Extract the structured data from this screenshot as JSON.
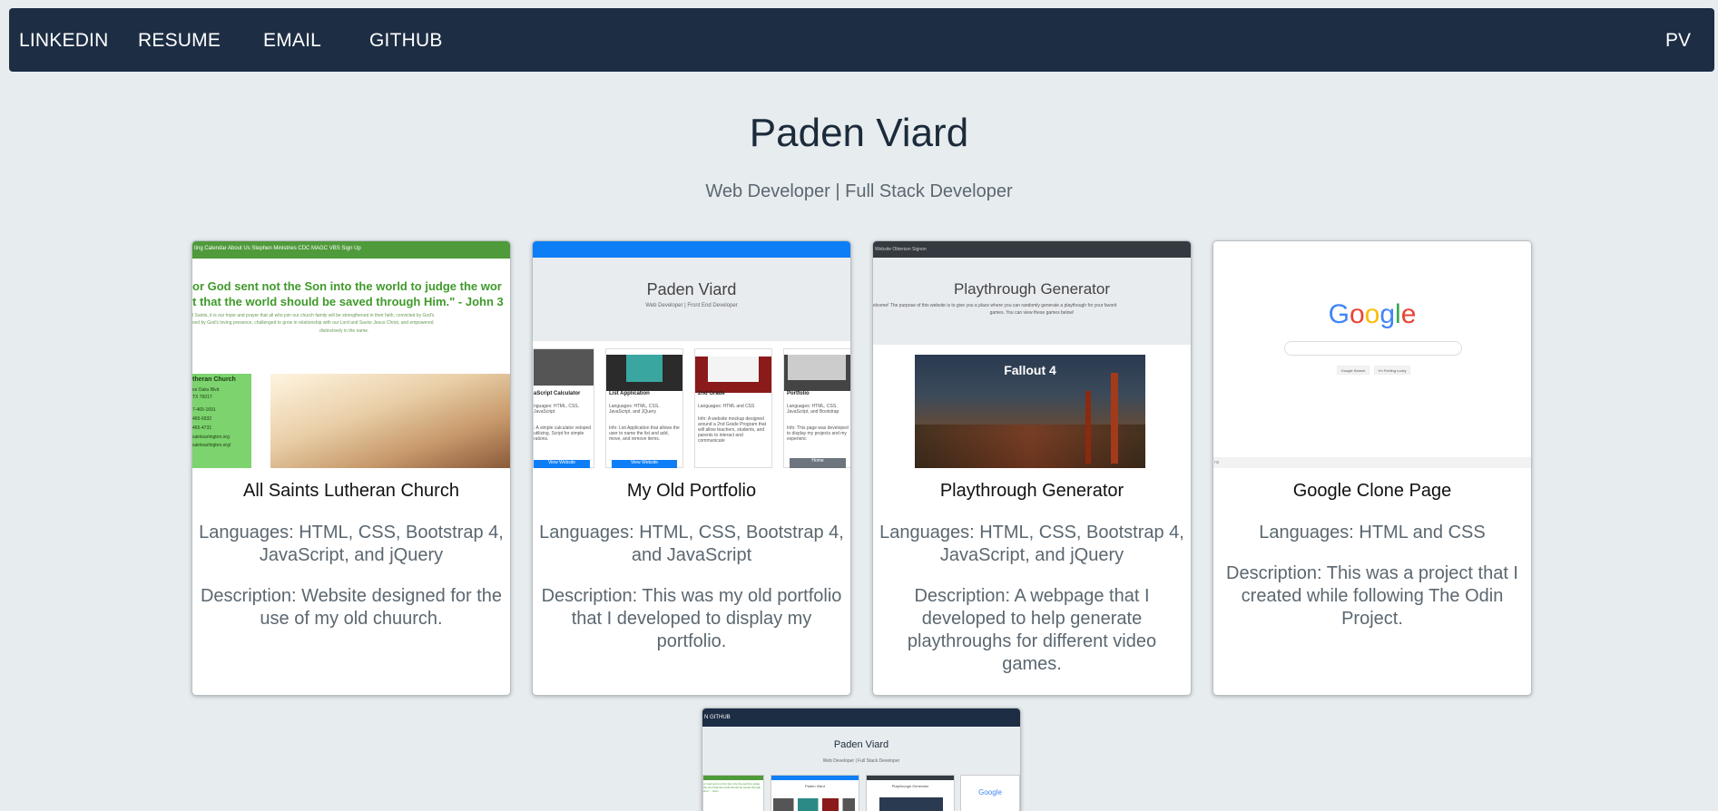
{
  "nav": {
    "links": [
      "LINKEDIN",
      "RESUME",
      "EMAIL",
      "GITHUB"
    ],
    "brand": "PV"
  },
  "hero": {
    "title": "Paden Viard",
    "subtitle": "Web Developer | Full Stack Developer"
  },
  "projects": [
    {
      "title": "All Saints Lutheran Church",
      "languages": "Languages: HTML, CSS, Bootstrap 4, JavaScript, and jQuery",
      "description": "Description: Website designed for the use of my old chuurch.",
      "thumb": {
        "nav_items": "ting  Calendar  About Us  Stephen Ministries  CDC  MAGC  VBS Sign Up",
        "quote_line1": "or God sent not the Son into the world to judge the wor",
        "quote_line2": "t that the world should be saved through Him.\" - John 3",
        "body_line1": "l Saints, it is our hope and prayer that all who join our church family will be strengthened in their faith, convicted by God's",
        "body_line2": "ved by God's loving presence, challenged to grow in relationship with our Lord and Savior Jesus Christ, and empowered",
        "body_line3": "distinctively in the name.",
        "side_title": "theran Church",
        "side_lines": [
          "es Oaks Blvd",
          "TX 76017",
          "7-465-1691",
          "465-6932",
          "465-4731",
          "saintsarlington.org",
          "saintsarlington.org/"
        ]
      }
    },
    {
      "title": "My Old Portfolio",
      "languages": "Languages: HTML, CSS, Bootstrap 4, and JavaScript",
      "description": "Description: This was my old portfolio that I developed to display my portfolio.",
      "thumb": {
        "heading": "Paden Viard",
        "sub": "Web Developer | Front End Developer",
        "tiles": [
          {
            "title": "aScript Calculator",
            "lang": "nguages: HTML, CSS, JavaScript",
            "info": ": A simple calculator veloped utilizing. Script for simple rations.",
            "btn": "View Website"
          },
          {
            "title": "List Application",
            "lang": "Languages: HTML, CSS, JavaScript, and JQuery",
            "info": "Info: List Application that allows the user to name the list and add, move, and remove items.",
            "btn": "View Website"
          },
          {
            "title": "2nd Grade",
            "lang": "Languages: HTML and CSS",
            "info": "Info: A website mockup designed around a 2nd Grade Program that will allow teachers, students, and parents to interact and communicate",
            "btn": ""
          },
          {
            "title": "Portfolio",
            "lang": "Languages: HTML, CSS, JavaScript, and Bootstrap",
            "info": "Info: This page was developed to display my projects and my experienc",
            "btn": "Home"
          }
        ]
      }
    },
    {
      "title": "Playthrough Generator",
      "languages": "Languages: HTML, CSS, Bootstrap 4, JavaScript, and jQuery",
      "description": "Description: A webpage that I developed to help generate playthroughs for different video games.",
      "thumb": {
        "nav_items": "Website   Obtenion   Signon",
        "heading": "Playthrough Generator",
        "intro1": "elcome! The purpose of this website is to give you a place where you can randomly generate a playthough for your favorit",
        "intro2": "games. You can view these games below!",
        "game_title": "Fallout 4"
      }
    },
    {
      "title": "Google Clone Page",
      "languages": "Languages: HTML and CSS",
      "description": "Description: This was a project that I created while following The Odin Project.",
      "thumb": {
        "logo": "Google",
        "btn1": "Google Search",
        "btn2": "I'm Feeling Lucky",
        "footer": "ns"
      }
    },
    {
      "thumb": {
        "nav_items": "N    GITHUB",
        "heading": "Paden Viard",
        "sub": "Web Developer | Full Stack Developer",
        "mini_quote": "or God sent not the Son into the world to judge the worl that the world should be saved through Him.\" - John",
        "mini_portfolio": "Paden Viard",
        "mini_play": "Playthrough Generator",
        "mini_google": "Google"
      }
    }
  ],
  "colors": {
    "nav_bg": "#1d2d44",
    "page_bg": "#e7ecef",
    "church_green": "#4f9a3a",
    "portfolio_blue": "#0d7ef5",
    "play_dark": "#343a40"
  }
}
